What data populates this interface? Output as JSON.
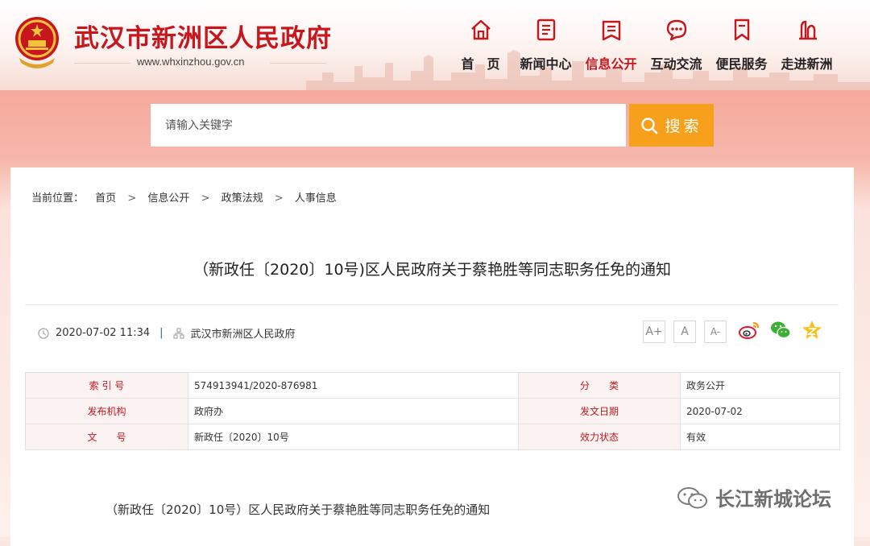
{
  "header": {
    "site_title": "武汉市新洲区人民政府",
    "site_url": "www.whxinzhou.gov.cn",
    "brand_color": "#c8161d"
  },
  "nav": {
    "items": [
      {
        "label": "首　页",
        "icon": "home-icon"
      },
      {
        "label": "新闻中心",
        "icon": "news-icon"
      },
      {
        "label": "信息公开",
        "icon": "info-icon",
        "active": true
      },
      {
        "label": "互动交流",
        "icon": "chat-icon"
      },
      {
        "label": "便民服务",
        "icon": "bookmark-icon"
      },
      {
        "label": "走进新洲",
        "icon": "landmark-icon"
      }
    ]
  },
  "search": {
    "placeholder": "请输入关键字",
    "button_label": "搜索",
    "button_color": "#f7a01c"
  },
  "breadcrumb": {
    "prefix": "当前位置：",
    "items": [
      "首页",
      "信息公开",
      "政策法规",
      "人事信息"
    ],
    "separator": ">"
  },
  "article": {
    "title": "（新政任〔2020〕10号)区人民政府关于蔡艳胜等同志职务任免的通知",
    "date": "2020-07-02 11:34",
    "source": "武汉市新洲区人民政府",
    "font_sizes": [
      "A+",
      "A",
      "A-"
    ],
    "share": [
      "weibo-icon",
      "wechat-icon",
      "qzone-icon"
    ],
    "body_first_line": "（新政任〔2020〕10号）区人民政府关于蔡艳胜等同志职务任免的通知"
  },
  "info_table": {
    "rows": [
      {
        "label1": "索 引 号",
        "value1": "574913941/2020-876981",
        "label2": "分　　类",
        "value2": "政务公开"
      },
      {
        "label1": "发布机构",
        "value1": "政府办",
        "label2": "发文日期",
        "value2": "2020-07-02"
      },
      {
        "label1": "文　　号",
        "value1": "新政任〔2020〕10号",
        "label2": "效力状态",
        "value2": "有效"
      }
    ]
  },
  "watermark": {
    "text": "长江新城论坛"
  }
}
